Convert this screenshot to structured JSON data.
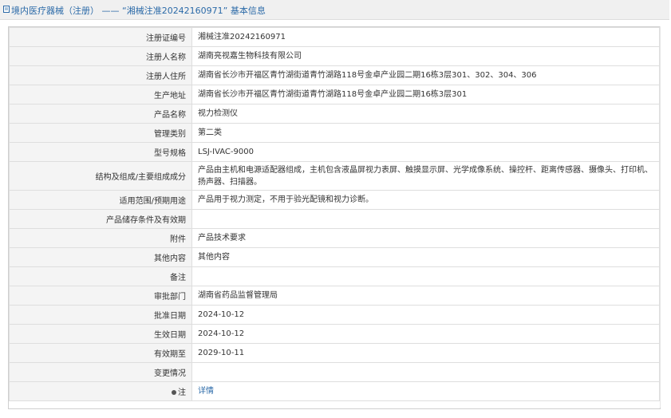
{
  "header": {
    "title": "境内医疗器械（注册） —— “湘械注准20242160971” 基本信息"
  },
  "rows": [
    {
      "label": "注册证编号",
      "value": "湘械注准20242160971"
    },
    {
      "label": "注册人名称",
      "value": "湖南亮视嘉生物科技有限公司"
    },
    {
      "label": "注册人住所",
      "value": "湖南省长沙市开福区青竹湖街道青竹湖路118号金卓产业园二期16栋3层301、302、304、306"
    },
    {
      "label": "生产地址",
      "value": "湖南省长沙市开福区青竹湖街道青竹湖路118号金卓产业园二期16栋3层301"
    },
    {
      "label": "产品名称",
      "value": "视力检测仪"
    },
    {
      "label": "管理类别",
      "value": "第二类"
    },
    {
      "label": "型号规格",
      "value": "LSJ-IVAC-9000"
    },
    {
      "label": "结构及组成/主要组成成分",
      "value": "产品由主机和电源适配器组成，主机包含液晶屏视力表屏、触摸显示屏、光学成像系统、操控杆、距离传感器、摄像头、打印机、扬声器、扫描器。"
    },
    {
      "label": "适用范围/预期用途",
      "value": "产品用于视力测定，不用于验光配镜和视力诊断。"
    },
    {
      "label": "产品储存条件及有效期",
      "value": ""
    },
    {
      "label": "附件",
      "value": "产品技术要求"
    },
    {
      "label": "其他内容",
      "value": "其他内容"
    },
    {
      "label": "备注",
      "value": ""
    },
    {
      "label": "审批部门",
      "value": "湖南省药品监督管理局"
    },
    {
      "label": "批准日期",
      "value": "2024-10-12"
    },
    {
      "label": "生效日期",
      "value": "2024-10-12"
    },
    {
      "label": "有效期至",
      "value": "2029-10-11"
    },
    {
      "label": "变更情况",
      "value": ""
    },
    {
      "label": "注",
      "value": "详情"
    }
  ],
  "colors": {
    "accent": "#2b6aa8",
    "label_bg": "#f4f4f4",
    "border": "#dedede"
  }
}
